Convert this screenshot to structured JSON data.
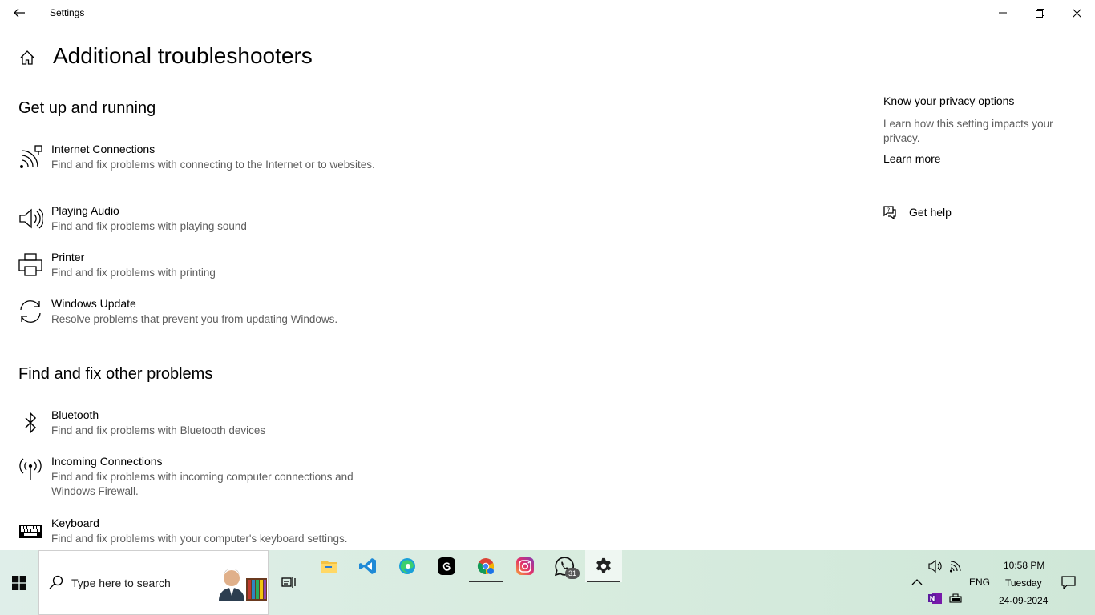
{
  "window": {
    "title": "Settings"
  },
  "page": {
    "title": "Additional troubleshooters"
  },
  "sections": [
    {
      "title": "Get up and running",
      "items": [
        {
          "name": "Internet Connections",
          "desc": "Find and fix problems with connecting to the Internet or to websites.",
          "icon": "internet-connections-icon"
        },
        {
          "name": "Playing Audio",
          "desc": "Find and fix problems with playing sound",
          "icon": "speaker-icon"
        },
        {
          "name": "Printer",
          "desc": "Find and fix problems with printing",
          "icon": "printer-icon"
        },
        {
          "name": "Windows Update",
          "desc": "Resolve problems that prevent you from updating Windows.",
          "icon": "refresh-icon"
        }
      ]
    },
    {
      "title": "Find and fix other problems",
      "items": [
        {
          "name": "Bluetooth",
          "desc": "Find and fix problems with Bluetooth devices",
          "icon": "bluetooth-icon"
        },
        {
          "name": "Incoming Connections",
          "desc": "Find and fix problems with incoming computer connections and Windows Firewall.",
          "icon": "antenna-icon"
        },
        {
          "name": "Keyboard",
          "desc": "Find and fix problems with your computer's keyboard settings.",
          "icon": "keyboard-icon"
        }
      ]
    }
  ],
  "sidebar": {
    "privacy_heading": "Know your privacy options",
    "privacy_text": "Learn how this setting impacts your privacy.",
    "learn_more": "Learn more",
    "get_help": "Get help"
  },
  "taskbar": {
    "search_placeholder": "Type here to search",
    "apps": [
      "file-explorer-icon",
      "vscode-icon",
      "edge-icon",
      "threads-icon",
      "chrome-icon",
      "instagram-icon",
      "whatsapp-icon",
      "settings-icon"
    ],
    "whatsapp_badge": "31",
    "language": "ENG",
    "time": "10:58 PM",
    "day": "Tuesday",
    "date": "24-09-2024"
  }
}
